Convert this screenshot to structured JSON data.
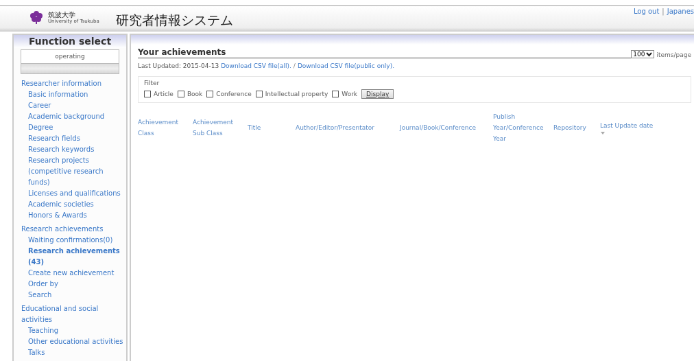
{
  "header": {
    "logo_text": "筑波大学",
    "logo_subtext": "University of Tsukuba",
    "title": "研究者情報システム",
    "links": [
      {
        "label": "Log out"
      },
      {
        "label": "Japanes"
      }
    ],
    "separator": "|"
  },
  "sidebar": {
    "title": "Function select",
    "status": "operating",
    "groups": [
      {
        "label": "Researcher information",
        "children": [
          {
            "label": "Basic information",
            "selected": false
          },
          {
            "label": "Career",
            "selected": false
          },
          {
            "label": "Academic background",
            "selected": false
          },
          {
            "label": "Degree",
            "selected": false
          },
          {
            "label": "Research fields",
            "selected": false
          },
          {
            "label": "Research keywords",
            "selected": false
          },
          {
            "label": "Research projects (competitive research funds)",
            "selected": false
          },
          {
            "label": "Licenses and qualifications",
            "selected": false
          },
          {
            "label": "Academic societies",
            "selected": false
          },
          {
            "label": "Honors & Awards",
            "selected": false
          }
        ]
      },
      {
        "label": "Research achievements",
        "children": [
          {
            "label": "Waiting confirmations(0)",
            "selected": false
          },
          {
            "label": "Research achievements (43)",
            "selected": true
          },
          {
            "label": "Create new achievement",
            "selected": false
          },
          {
            "label": "Order by",
            "selected": false
          },
          {
            "label": "Search",
            "selected": false
          }
        ]
      },
      {
        "label": "Educational and social activities",
        "children": [
          {
            "label": "Teaching",
            "selected": false
          },
          {
            "label": "Other educational activities",
            "selected": false
          },
          {
            "label": "Talks",
            "selected": false
          }
        ]
      }
    ]
  },
  "main": {
    "heading": "Your achievements",
    "per_page": {
      "value": "100",
      "label": "items/page"
    },
    "updated": "Last Updated: 2015-04-13",
    "downloads": [
      {
        "label": "Download CSV file(all)."
      },
      {
        "label": "Download CSV file(public only)."
      }
    ],
    "download_separator": "/",
    "filter": {
      "legend": "Filter",
      "options": [
        {
          "label": "Article",
          "checked": false
        },
        {
          "label": "Book",
          "checked": false
        },
        {
          "label": "Conference",
          "checked": false
        },
        {
          "label": "Intellectual property",
          "checked": false
        },
        {
          "label": "Work",
          "checked": false
        }
      ],
      "button": "Display"
    },
    "table": {
      "columns": [
        {
          "label": "Achievement Class",
          "sorted": false
        },
        {
          "label": "Achievement Sub Class",
          "sorted": false
        },
        {
          "label": "Title",
          "sorted": false
        },
        {
          "label": "Author/Editor/Presentator",
          "sorted": false
        },
        {
          "label": "Journal/Book/Conference",
          "sorted": false
        },
        {
          "label": "Publish Year/Conference Year",
          "sorted": false
        },
        {
          "label": "Repository",
          "sorted": false
        },
        {
          "label": "Last Update date",
          "sorted": true
        }
      ]
    }
  }
}
